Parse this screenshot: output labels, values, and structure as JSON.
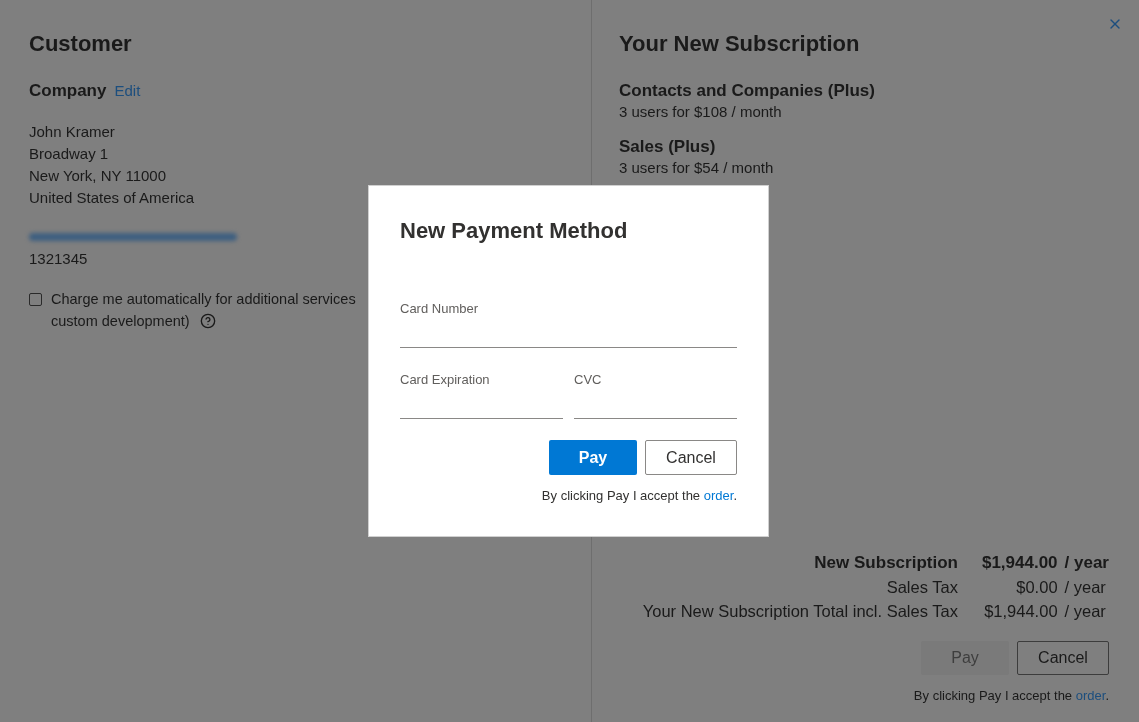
{
  "customer": {
    "title": "Customer",
    "company": {
      "heading": "Company",
      "edit_link": "Edit"
    },
    "address_lines": [
      "John Kramer",
      "Broadway 1",
      "New York, NY 11000",
      "United States of America"
    ],
    "phone": "1321345",
    "auto_charge": {
      "checked": false,
      "label_lines": [
        "Charge me automatically for additional services",
        "custom development)"
      ]
    }
  },
  "subscription": {
    "title": "Your New Subscription",
    "items": [
      {
        "name": "Contacts and Companies (Plus)",
        "detail": "3 users for $108 / month"
      },
      {
        "name": "Sales (Plus)",
        "detail": "3 users for $54 / month"
      }
    ],
    "summary": [
      {
        "label": "New Subscription",
        "amount": "$1,944.00",
        "period": "/ year",
        "emphasized": true
      },
      {
        "label": "Sales Tax",
        "amount": "$0.00",
        "period": "/ year",
        "emphasized": false
      },
      {
        "label": "Your New Subscription Total incl. Sales Tax",
        "amount": "$1,944.00",
        "period": "/ year",
        "emphasized": false
      }
    ],
    "buttons": [
      {
        "label": "Pay",
        "kind": "primary",
        "disabled": true
      },
      {
        "label": "Cancel",
        "kind": "secondary",
        "disabled": false
      }
    ],
    "terms": {
      "before": "By clicking Pay I accept the",
      "link": "order",
      "after": "."
    }
  },
  "dialog": {
    "title": "New Payment Method",
    "fields": [
      {
        "label": "Card Number"
      },
      {
        "label": "Card Expiration"
      },
      {
        "label": "CVC"
      }
    ],
    "buttons": [
      {
        "label": "Pay",
        "kind": "primary",
        "disabled": false
      },
      {
        "label": "Cancel",
        "kind": "secondary",
        "disabled": false
      }
    ],
    "terms": {
      "before": "By clicking Pay I accept the",
      "link": "order",
      "after": "."
    }
  }
}
